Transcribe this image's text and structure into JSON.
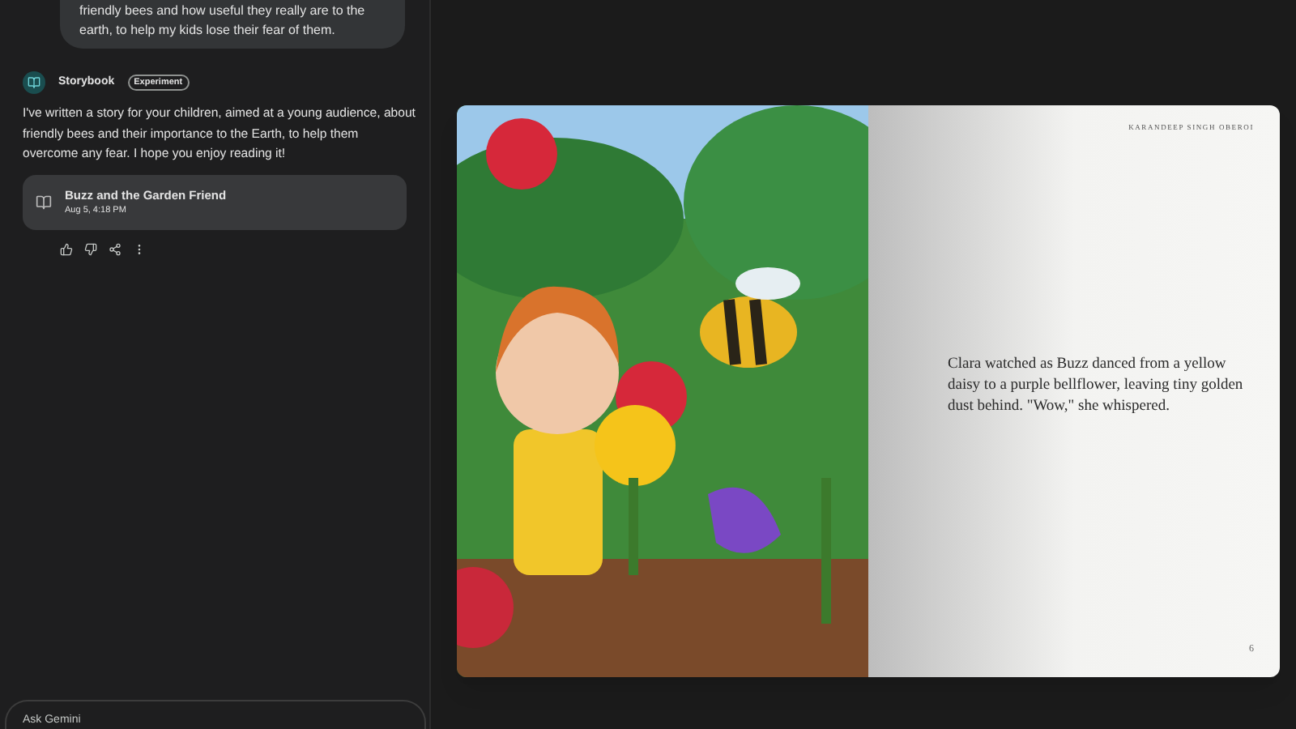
{
  "chat": {
    "user_message": "friendly bees and how useful they really are to the earth, to help my kids lose their fear of them.",
    "response": {
      "agent": "Storybook",
      "badge": "Experiment",
      "text": "I've written a story for your children, aimed at a young audience, about friendly bees and their importance to the Earth, to help them overcome any fear. I hope you enjoy reading it!",
      "story_card": {
        "title": "Buzz and the Garden Friend",
        "date": "Aug 5, 4:18 PM"
      }
    }
  },
  "input": {
    "placeholder": "Ask Gemini"
  },
  "book": {
    "author": "KARANDEEP SINGH OBEROI",
    "text": "Clara watched as Buzz danced from a yellow daisy to a purple bellflower, leaving tiny golden dust behind. \"Wow,\" she whispered.",
    "page_number": "6"
  }
}
